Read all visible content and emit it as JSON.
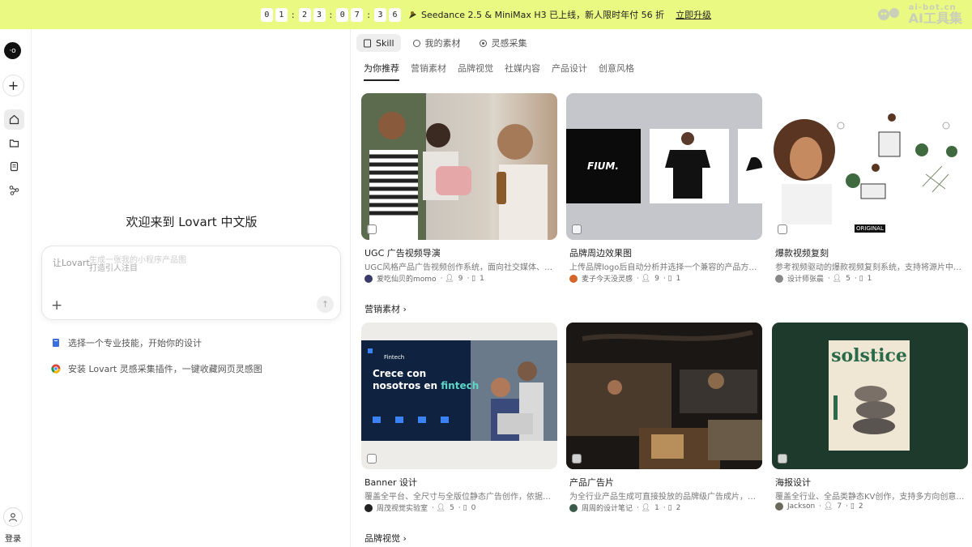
{
  "banner": {
    "countdown": [
      "0",
      "1",
      ":",
      "2",
      "3",
      ":",
      "0",
      "7",
      ":",
      "3",
      "6"
    ],
    "promo": "Seedance 2.5 & MiniMax H3 已上线，新人限时年付 56 折",
    "upgrade": "立即升级",
    "watermark_domain": "ai-bot.cn",
    "watermark_text": "AI工具集"
  },
  "rail": {
    "login": "登录"
  },
  "left": {
    "welcome": "欢迎来到 Lovart 中文版",
    "placeholder_main": "让Lovart",
    "placeholder_ghost": "生成一张我的小程序产品图",
    "placeholder_sub": "打造引人注目",
    "hint1": "选择一个专业技能，开始你的设计",
    "hint2": "安装 Lovart 灵感采集插件，一键收藏网页灵感图"
  },
  "top_tabs": [
    {
      "label": "Skill",
      "icon": "skill-icon"
    },
    {
      "label": "我的素材",
      "icon": "assets-icon"
    },
    {
      "label": "灵感采集",
      "icon": "inspiration-icon"
    }
  ],
  "cat_tabs": [
    "为你推荐",
    "营销素材",
    "品牌视觉",
    "社媒内容",
    "产品设计",
    "创意风格"
  ],
  "cards": [
    {
      "title": "UGC 广告视频导演",
      "desc": "UGC风格产品广告视频创作系统，面向社交媒体、…",
      "author": "爱吃仙贝的momo",
      "users": "9",
      "saves": "1"
    },
    {
      "title": "品牌周边效果图",
      "desc": "上传品牌logo后自动分析并选择一个兼容的产品方…",
      "author": "麦子今天没灵感",
      "users": "9",
      "saves": "1",
      "logo_text": "FIUM."
    },
    {
      "title": "爆款视频复刻",
      "desc": "参考视频驱动的爆款视频复刻系统，支持将源片中的…",
      "author": "设计师张晨",
      "users": "5",
      "saves": "1",
      "badge": "ORIGINAL"
    },
    {
      "title": "Banner 设计",
      "desc": "覆盖全平台、全尺寸与全版位静态广告创作，依据品…",
      "author": "周茂视觉实验室",
      "users": "5",
      "saves": "0",
      "brand": "Fintech",
      "headline1": "Crece con",
      "headline2": "nosotros en",
      "headline3": "fintech"
    },
    {
      "title": "产品广告片",
      "desc": "为全行业产品生成可直接投放的品牌级广告成片，涵…",
      "author": "周周的设计笔记",
      "users": "1",
      "saves": "2"
    },
    {
      "title": "海报设计",
      "desc": "覆盖全行业、全品类静态KV创作，支持多方向创意…",
      "author": "Jackson",
      "users": "7",
      "saves": "2",
      "poster_word": "solstice"
    }
  ],
  "sections": {
    "marketing": "营销素材",
    "brand": "品牌视觉"
  }
}
